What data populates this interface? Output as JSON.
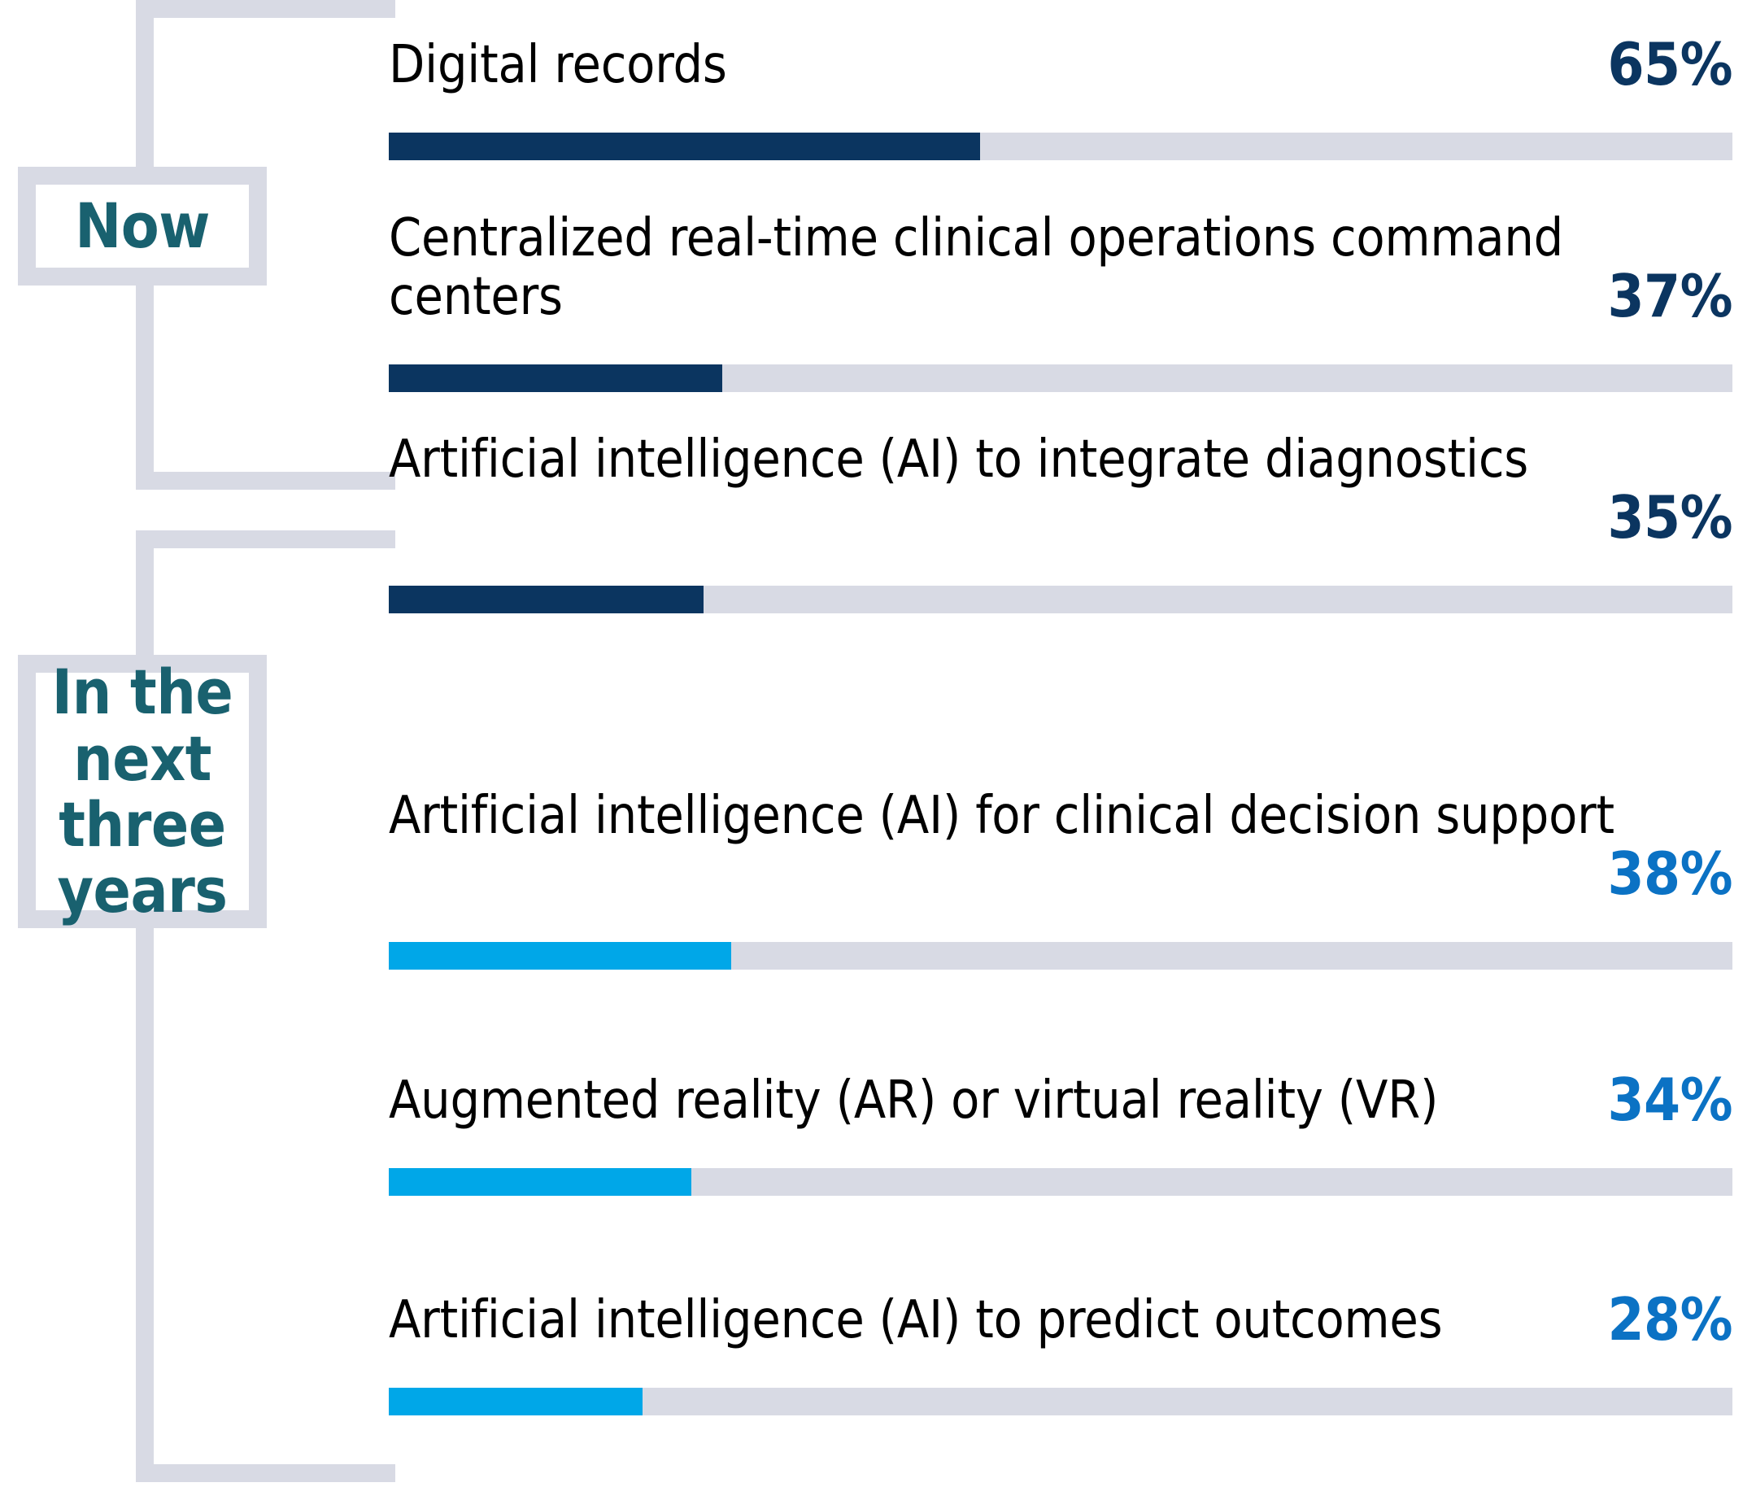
{
  "chart_data": {
    "type": "bar",
    "title": "",
    "subtitle": "",
    "xlabel": "",
    "ylabel": "",
    "xlim": [
      0,
      100
    ],
    "grid": false,
    "legend_position": "none",
    "orientation": "horizontal",
    "groups": [
      {
        "name": "Now",
        "label_lines": [
          "Now"
        ],
        "bar_color": "#0b3560",
        "value_color": "#0b3560",
        "track_color": "#d8dae4",
        "items": [
          {
            "label": "Digital records",
            "label_lines": [
              "Digital records"
            ],
            "value": 65,
            "value_text": "65%"
          },
          {
            "label": "Centralized real-time clinical operations command centers",
            "label_lines": [
              "Centralized real-time clinical operations",
              "command centers"
            ],
            "value": 37,
            "value_text": "37%"
          },
          {
            "label": "Artificial intelligence (AI) to integrate diagnostics",
            "label_lines": [
              "Artificial intelligence (AI)",
              "to integrate diagnostics"
            ],
            "value": 35,
            "value_text": "35%"
          }
        ]
      },
      {
        "name": "In the next three years",
        "label_lines": [
          "In the",
          "next",
          "three",
          "years"
        ],
        "bar_color": "#00a7e8",
        "value_color": "#0b72c4",
        "track_color": "#d8dae4",
        "items": [
          {
            "label": "Artificial intelligence (AI) for clinical decision support",
            "label_lines": [
              "Artificial intelligence (AI) for",
              "clinical decision support"
            ],
            "value": 38,
            "value_text": "38%"
          },
          {
            "label": "Augmented reality (AR) or virtual reality (VR)",
            "label_lines": [
              "Augmented reality (AR) or virtual reality (VR)"
            ],
            "value": 34,
            "value_text": "34%"
          },
          {
            "label": "Artificial intelligence (AI) to predict outcomes",
            "label_lines": [
              "Artificial intelligence (AI) to predict outcomes"
            ],
            "value": 28,
            "value_text": "28%"
          }
        ]
      }
    ]
  },
  "groups": {
    "now": {
      "label": "Now",
      "items": [
        {
          "label": "Digital records",
          "value_text": "65%"
        },
        {
          "label": "Centralized real-time clinical operations\ncommand centers",
          "value_text": "37%"
        },
        {
          "label": "Artificial intelligence (AI)\nto integrate diagnostics",
          "value_text": "35%"
        }
      ]
    },
    "next_three_years": {
      "label": "In the\nnext\nthree\nyears",
      "items": [
        {
          "label": "Artificial intelligence (AI) for\nclinical decision support",
          "value_text": "38%"
        },
        {
          "label": "Augmented reality (AR) or virtual reality (VR)",
          "value_text": "34%"
        },
        {
          "label": "Artificial intelligence (AI) to predict outcomes",
          "value_text": "28%"
        }
      ]
    }
  },
  "colors": {
    "now_bar": "#0b3560",
    "now_value": "#0b3560",
    "future_bar": "#00a7e8",
    "future_value": "#0b72c4",
    "track": "#d8dae4",
    "bracket": "#d8dae4",
    "period_text": "#19616f",
    "label_text": "#000000",
    "background": "#ffffff"
  }
}
